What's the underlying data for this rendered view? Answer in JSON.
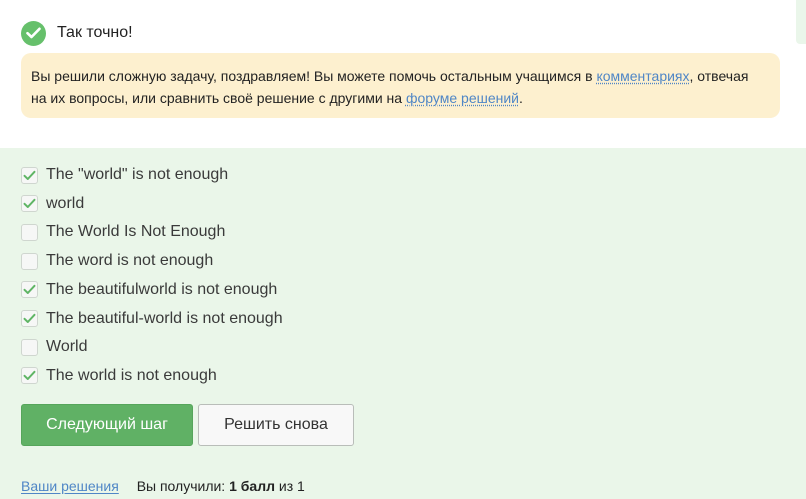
{
  "result": {
    "text": "Так точно!",
    "icon": "check-circle-icon",
    "color": "#66c06b"
  },
  "note": {
    "text_before": "Вы решили сложную задачу, поздравляем! Вы можете помочь остальным учащимся в ",
    "comments_link": "комментариях",
    "text_middle": ", отвечая на их вопросы, или сравнить своё решение с другими на ",
    "forum_link": "форуме решений",
    "text_after": "."
  },
  "options": [
    {
      "label": "The \"world\" is not enough",
      "checked": true
    },
    {
      "label": "world",
      "checked": true
    },
    {
      "label": "The World Is Not Enough",
      "checked": false
    },
    {
      "label": "The word is not enough",
      "checked": false
    },
    {
      "label": "The beautifulworld is not enough",
      "checked": true
    },
    {
      "label": "The beautiful-world is not enough",
      "checked": true
    },
    {
      "label": "World",
      "checked": false
    },
    {
      "label": "The world is not enough",
      "checked": true
    }
  ],
  "buttons": {
    "next": "Следующий шаг",
    "retry": "Решить снова"
  },
  "footer": {
    "solutions_link": "Ваши решения",
    "score_prefix": "Вы получили: ",
    "score_value": "1 балл",
    "score_suffix": " из 1"
  },
  "colors": {
    "accent": "#60b165",
    "link": "#4f86c6",
    "note_bg": "#fdf0cf",
    "answers_bg": "#eaf6e9"
  }
}
